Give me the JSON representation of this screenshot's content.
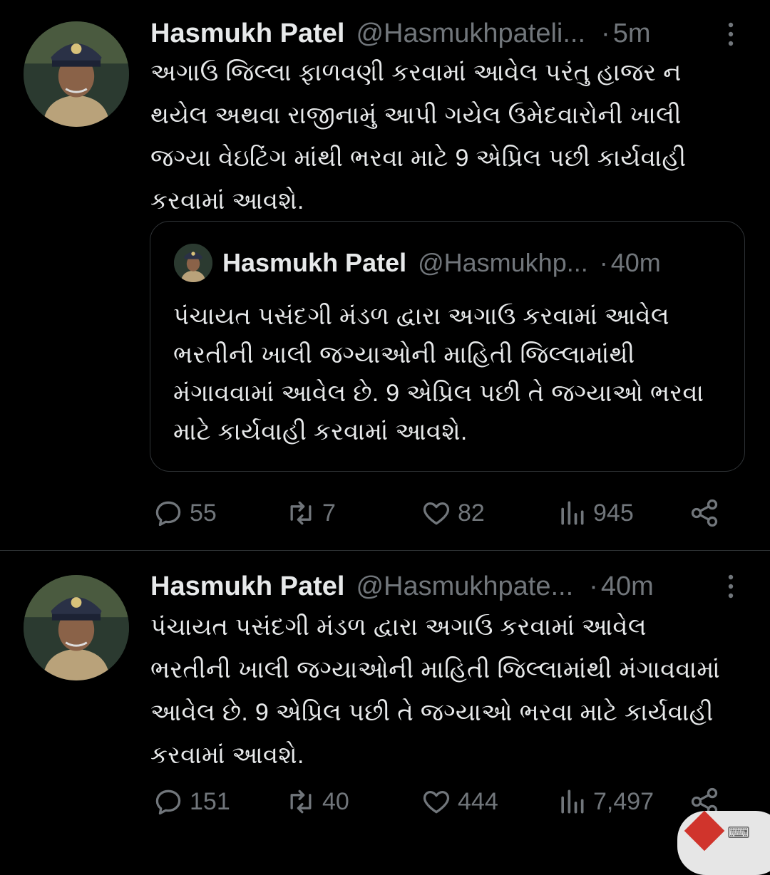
{
  "tweets": [
    {
      "author_name": "Hasmukh Patel",
      "author_handle": "@Hasmukhpateli...",
      "separator": "·",
      "time": "5m",
      "text": "અગાઉ જિલ્લા ફાળવણી કરવામાં આવેલ પરંતુ હાજર ન થયેલ અથવા રાજીનામું આપી ગયેલ ઉમેદવારોની ખાલી જગ્યા વેઇટિંગ માંથી ભરવા માટે 9 એપ્રિલ પછી કાર્યવાહી કરવામાં આવશે.",
      "quote": {
        "author_name": "Hasmukh Patel",
        "author_handle": "@Hasmukhp...",
        "separator": "·",
        "time": "40m",
        "text": "પંચાયત પસંદગી મંડળ દ્વારા અગાઉ કરવામાં આવેલ ભરતીની ખાલી જગ્યાઓની માહિતી જિલ્લામાંથી મંગાવવામાં આવેલ છે. 9 એપ્રિલ પછી તે જગ્યાઓ ભરવા માટે કાર્યવાહી કરવામાં આવશે."
      },
      "stats": {
        "replies": "55",
        "retweets": "7",
        "likes": "82",
        "views": "945"
      }
    },
    {
      "author_name": "Hasmukh Patel",
      "author_handle": "@Hasmukhpate...",
      "separator": "·",
      "time": "40m",
      "text": "પંચાયત પસંદગી મંડળ દ્વારા અગાઉ કરવામાં આવેલ ભરતીની ખાલી જગ્યાઓની માહિતી જિલ્લામાંથી મંગાવવામાં આવેલ છે. 9 એપ્રિલ પછી તે જગ્યાઓ ભરવા માટે કાર્યવાહી કરવામાં આવશે.",
      "stats": {
        "replies": "151",
        "retweets": "40",
        "likes": "444",
        "views": "7,497"
      }
    }
  ],
  "icons": {
    "reply": "reply-icon",
    "retweet": "retweet-icon",
    "like": "heart-icon",
    "views": "views-icon",
    "share": "share-icon",
    "more": "more-icon"
  },
  "colors": {
    "background": "#000000",
    "text": "#e7e9ea",
    "muted": "#71767b",
    "border": "#2f3336"
  }
}
